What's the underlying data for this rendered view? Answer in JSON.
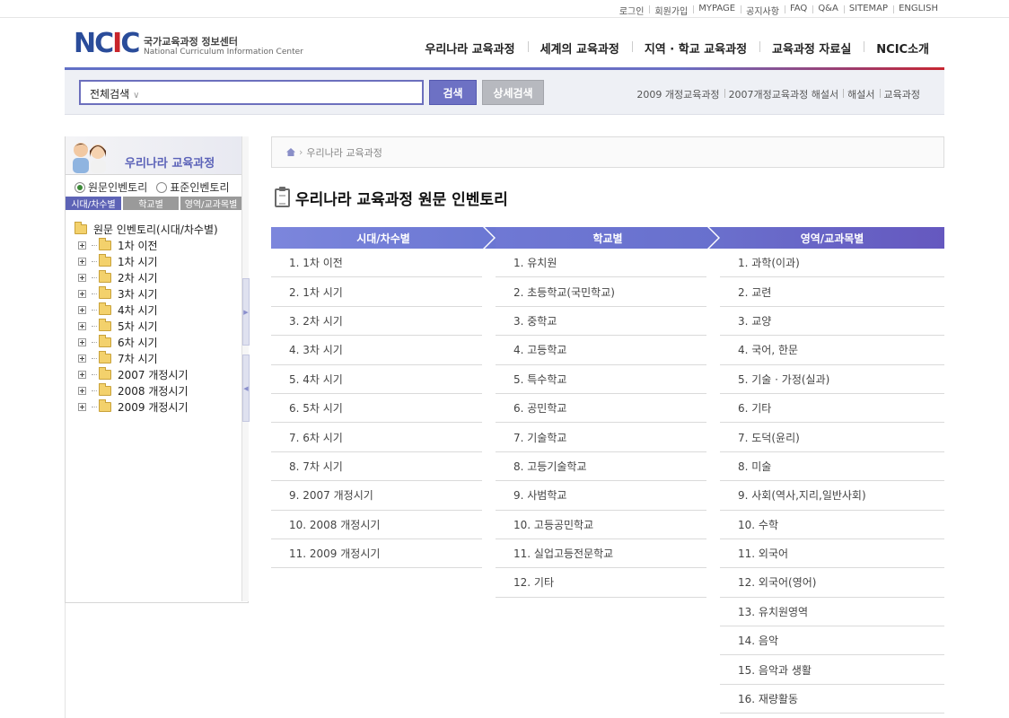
{
  "util_links": [
    "로그인",
    "회원가입",
    "MYPAGE",
    "공지사항",
    "FAQ",
    "Q&A",
    "SITEMAP",
    "ENGLISH"
  ],
  "logo": {
    "mark": "NCIC",
    "ko": "국가교육과정 정보센터",
    "en": "National Curriculum Information Center"
  },
  "gnb": [
    "우리나라 교육과정",
    "세계의 교육과정",
    "지역 · 학교 교육과정",
    "교육과정 자료실",
    "NCIC소개"
  ],
  "search": {
    "scope": "전체검색",
    "placeholder": "",
    "button": "검색",
    "advanced": "상세검색"
  },
  "quick_links": [
    "2009 개정교육과정",
    "2007개정교육과정 해설서",
    "해설서",
    "교육과정"
  ],
  "lnb": {
    "title": "우리나라 교육과정",
    "radios": [
      {
        "label": "원문인벤토리",
        "checked": true
      },
      {
        "label": "표준인벤토리",
        "checked": false
      }
    ],
    "tabs": [
      "시대/차수별",
      "학교별",
      "영역/교과목별"
    ],
    "tree_root": "원문 인벤토리(시대/차수별)",
    "tree_items": [
      "1차 이전",
      "1차 시기",
      "2차 시기",
      "3차 시기",
      "4차 시기",
      "5차 시기",
      "6차 시기",
      "7차 시기",
      "2007 개정시기",
      "2008 개정시기",
      "2009 개정시기"
    ]
  },
  "breadcrumb": "우리나라 교육과정",
  "page_title": "우리나라 교육과정 원문 인벤토리",
  "columns": [
    {
      "header": "시대/차수별",
      "items": [
        "1. 1차 이전",
        "2. 1차 시기",
        "3. 2차 시기",
        "4. 3차 시기",
        "5. 4차 시기",
        "6. 5차 시기",
        "7. 6차 시기",
        "8. 7차 시기",
        "9. 2007 개정시기",
        "10. 2008 개정시기",
        "11. 2009 개정시기"
      ]
    },
    {
      "header": "학교별",
      "items": [
        "1. 유치원",
        "2. 초등학교(국민학교)",
        "3. 중학교",
        "4. 고등학교",
        "5. 특수학교",
        "6. 공민학교",
        "7. 기술학교",
        "8. 고등기술학교",
        "9. 사범학교",
        "10. 고등공민학교",
        "11. 실업고등전문학교",
        "12. 기타"
      ]
    },
    {
      "header": "영역/교과목별",
      "items": [
        "1. 과학(이과)",
        "2. 교련",
        "3. 교양",
        "4. 국어, 한문",
        "5. 기술 · 가정(실과)",
        "6. 기타",
        "7. 도덕(윤리)",
        "8. 미술",
        "9. 사회(역사,지리,일반사회)",
        "10. 수학",
        "11. 외국어",
        "12. 외국어(영어)",
        "13. 유치원영역",
        "14. 음악",
        "15. 음악과 생활",
        "16. 재량활동"
      ]
    }
  ],
  "colors": {
    "accent": "#6b72c9",
    "brand_red": "#c72631",
    "brand_blue": "#2a4c9a"
  }
}
